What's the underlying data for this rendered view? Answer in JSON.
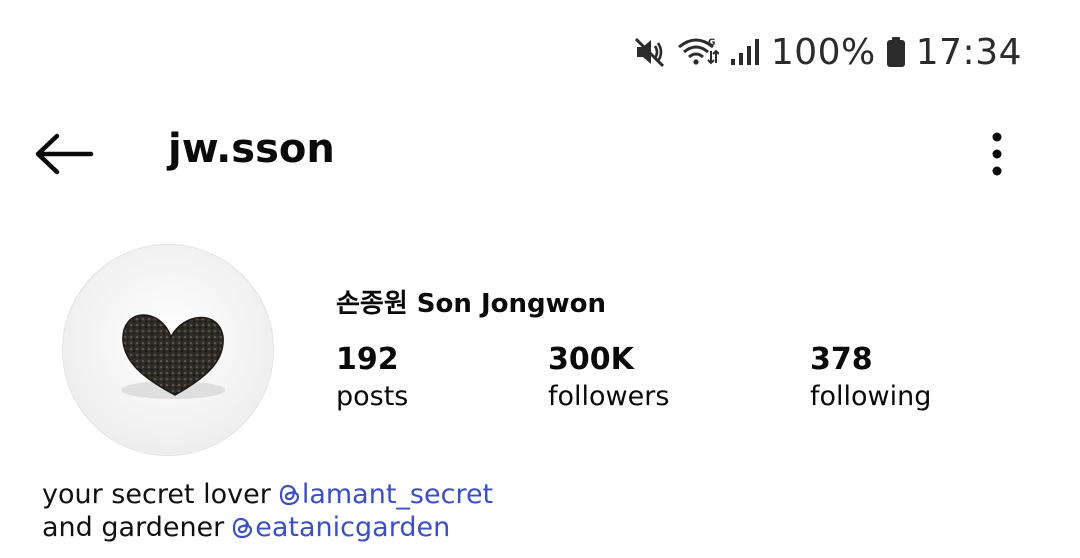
{
  "status_bar": {
    "battery": "100%",
    "time": "17:34",
    "icons": [
      "mute-icon",
      "wifi-icon",
      "signal-icon",
      "battery-icon"
    ]
  },
  "header": {
    "username": "jw.sson",
    "icons": [
      "back-arrow-icon",
      "more-vertical-icon"
    ]
  },
  "profile": {
    "full_name": "손종원 Son Jongwon",
    "stats": {
      "posts": {
        "value": "192",
        "label": "posts"
      },
      "followers": {
        "value": "300K",
        "label": "followers"
      },
      "following": {
        "value": "378",
        "label": "following"
      }
    }
  },
  "bio": {
    "line1_text": "your secret lover",
    "line1_mention": "lamant_secret",
    "line2_text": "and gardener",
    "line2_mention": "eatanicgarden",
    "mention_icon": "threads-icon",
    "mention_color": "#3b50c4"
  }
}
